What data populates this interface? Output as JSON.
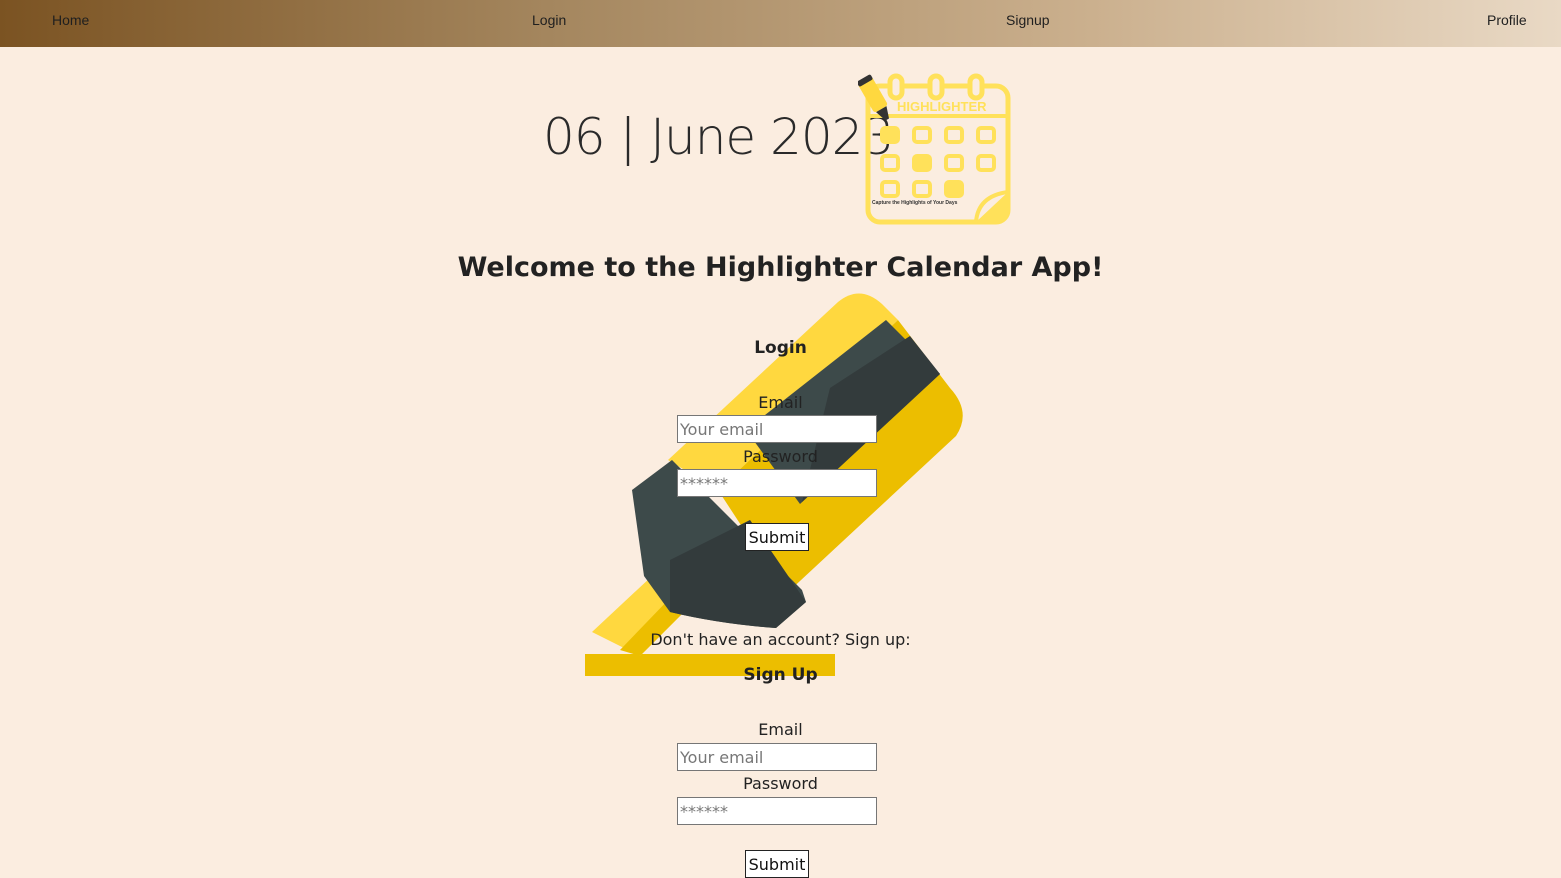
{
  "nav": {
    "home": "Home",
    "login": "Login",
    "signup": "Signup",
    "profile": "Profile"
  },
  "header": {
    "date": "06 | June 2023",
    "logo_title": "HIGHLIGHTER",
    "logo_tagline": "Capture the Highlights of Your Days"
  },
  "welcome": "Welcome to the Highlighter Calendar App!",
  "login_form": {
    "title": "Login",
    "email_label": "Email",
    "email_placeholder": "Your email",
    "password_label": "Password",
    "password_placeholder": "******",
    "submit": "Submit"
  },
  "signup_prompt": "Don't have an account? Sign up:",
  "signup_form": {
    "title": "Sign Up",
    "email_label": "Email",
    "email_placeholder": "Your email",
    "password_label": "Password",
    "password_placeholder": "******",
    "submit": "Submit"
  },
  "colors": {
    "background": "#fbede0",
    "highlighter_yellow": "#ffd83f",
    "highlighter_gold": "#ecbe00",
    "highlighter_dark": "#3d4a4a"
  }
}
